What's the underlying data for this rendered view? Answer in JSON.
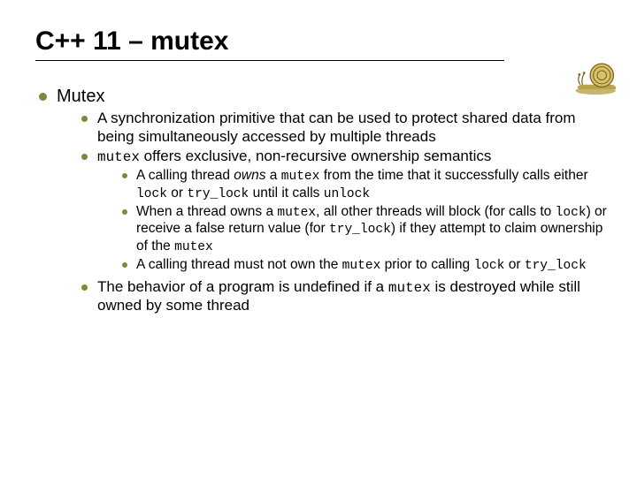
{
  "title": "C++ 11 – mutex",
  "bullets": {
    "l1_1": "Mutex",
    "l2_1": "A synchronization primitive that can be used to protect shared data from being simultaneously accessed by multiple threads",
    "l2_2_a": "mutex",
    "l2_2_b": " offers exclusive, non-recursive ownership semantics",
    "l3_1_a": "A calling thread ",
    "l3_1_own": "owns",
    "l3_1_b": " a ",
    "l3_1_mutex": "mutex",
    "l3_1_c": " from the time that it successfully calls either ",
    "l3_1_lock": "lock",
    "l3_1_d": " or ",
    "l3_1_try": "try_lock",
    "l3_1_e": " until it calls ",
    "l3_1_unlock": "unlock",
    "l3_2_a": "When a thread owns a ",
    "l3_2_mutex": "mutex",
    "l3_2_b": ", all other threads will block (for calls to ",
    "l3_2_lock": "lock",
    "l3_2_c": ") or receive a false return value (for ",
    "l3_2_try": "try_lock",
    "l3_2_d": ") if they attempt to claim ownership of the ",
    "l3_2_mutex2": "mutex",
    "l3_3_a": "A calling thread must not own the ",
    "l3_3_mutex": "mutex",
    "l3_3_b": " prior to calling ",
    "l3_3_lock": "lock",
    "l3_3_c": " or ",
    "l3_3_try": "try_lock",
    "l2_3_a": "The behavior of a program is undefined if a ",
    "l2_3_mutex": "mutex",
    "l2_3_b": " is destroyed while still owned by some thread"
  }
}
